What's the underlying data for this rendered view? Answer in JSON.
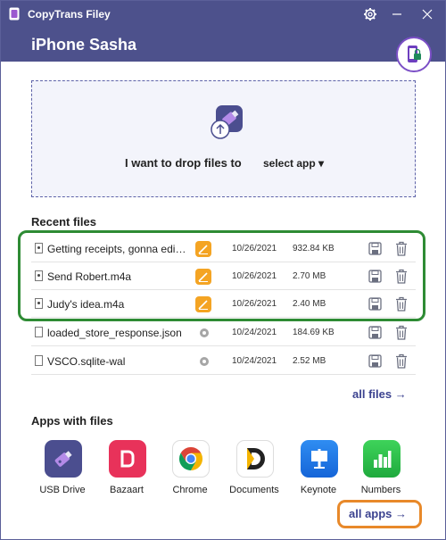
{
  "window": {
    "title": "CopyTrans Filey"
  },
  "header": {
    "device_name": "iPhone Sasha"
  },
  "dropzone": {
    "text": "I want to drop files to",
    "select_label": "select app ▾"
  },
  "recent": {
    "title": "Recent files",
    "files": [
      {
        "name": "Getting receipts, gonna edit ...",
        "app": "pages",
        "date": "10/26/2021",
        "size": "932.84 KB",
        "type": "audio"
      },
      {
        "name": "Send Robert.m4a",
        "app": "pages",
        "date": "10/26/2021",
        "size": "2.70 MB",
        "type": "audio"
      },
      {
        "name": "Judy's idea.m4a",
        "app": "pages",
        "date": "10/26/2021",
        "size": "2.40 MB",
        "type": "audio"
      },
      {
        "name": "loaded_store_response.json",
        "app": "other",
        "date": "10/24/2021",
        "size": "184.69 KB",
        "type": "doc"
      },
      {
        "name": "VSCO.sqlite-wal",
        "app": "other",
        "date": "10/24/2021",
        "size": "2.52 MB",
        "type": "doc"
      }
    ],
    "all_files_label": "all files →"
  },
  "apps": {
    "title": "Apps with files",
    "items": [
      {
        "label": "USB Drive",
        "icon": "usb-drive-icon"
      },
      {
        "label": "Bazaart",
        "icon": "bazaart-icon"
      },
      {
        "label": "Chrome",
        "icon": "chrome-icon"
      },
      {
        "label": "Documents",
        "icon": "documents-icon"
      },
      {
        "label": "Keynote",
        "icon": "keynote-icon"
      },
      {
        "label": "Numbers",
        "icon": "numbers-icon"
      }
    ],
    "all_apps_label": "all apps →"
  },
  "colors": {
    "header": "#4d518c",
    "accent_link": "#3c4390",
    "highlight_green": "#2e8b34",
    "highlight_orange": "#e8892a",
    "pages_orange": "#f4a423"
  }
}
